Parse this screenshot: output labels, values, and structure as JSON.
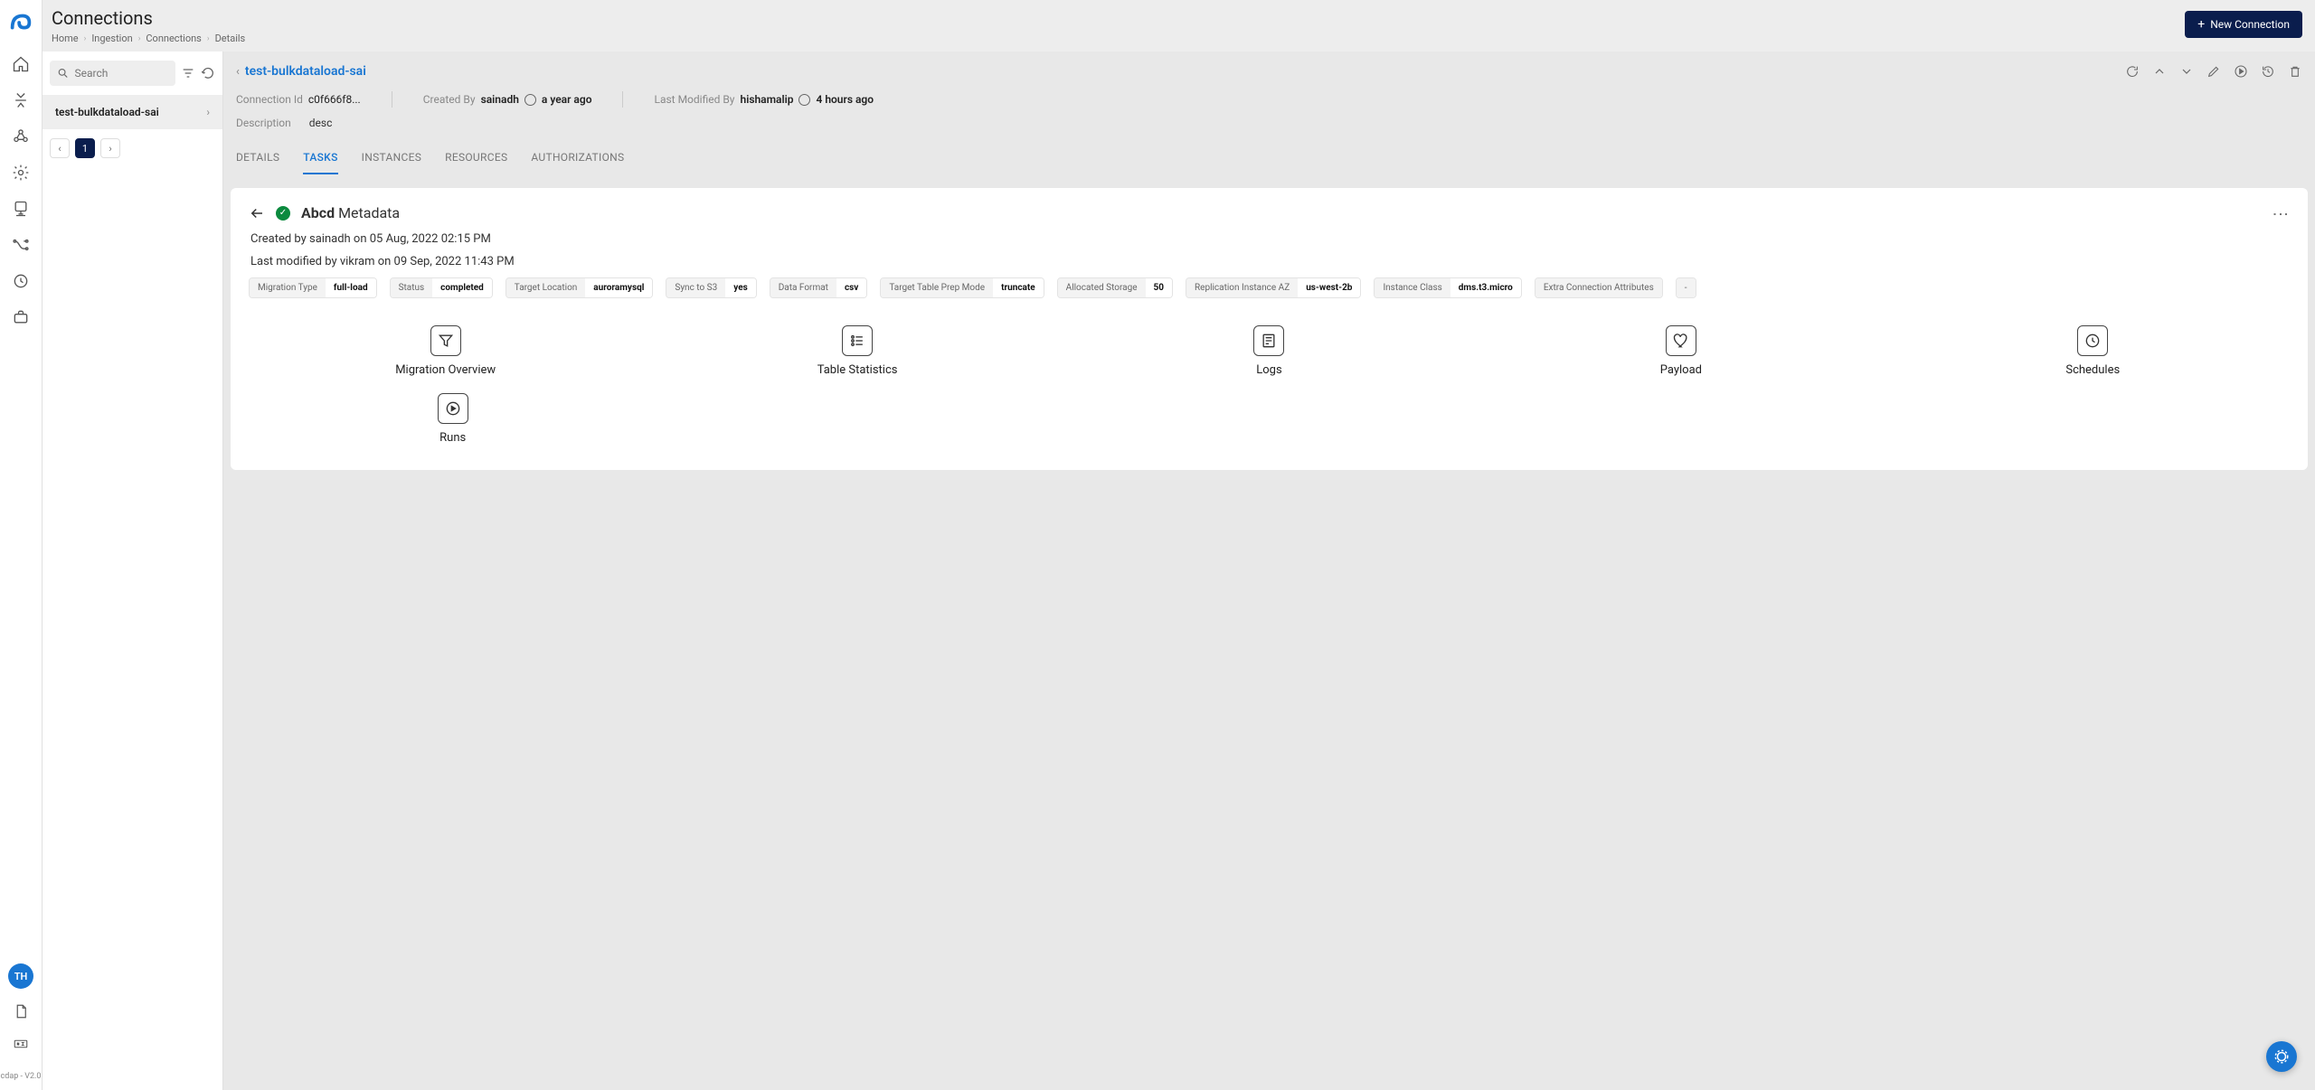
{
  "page": {
    "title": "Connections",
    "breadcrumb": [
      "Home",
      "Ingestion",
      "Connections",
      "Details"
    ],
    "new_connection_btn": "New Connection",
    "version": "cdap - V2.0"
  },
  "search": {
    "placeholder": "Search"
  },
  "avatar": {
    "initials": "TH"
  },
  "sidebar": {
    "items": [
      {
        "label": "test-bulkdataload-sai"
      }
    ],
    "current_page": "1"
  },
  "connection": {
    "name": "test-bulkdataload-sai",
    "id_label": "Connection Id",
    "id_value": "c0f666f8...",
    "created_by_label": "Created By",
    "created_by_value": "sainadh",
    "created_by_time": "a year ago",
    "modified_by_label": "Last Modified By",
    "modified_by_value": "hishamalip",
    "modified_by_time": "4 hours ago",
    "description_label": "Description",
    "description_value": "desc"
  },
  "tabs": {
    "details": "DETAILS",
    "tasks": "TASKS",
    "instances": "INSTANCES",
    "resources": "RESOURCES",
    "authorizations": "AUTHORIZATIONS"
  },
  "task": {
    "name_bold": "Abcd",
    "name_rest": "Metadata",
    "created_line": "Created by sainadh on 05 Aug, 2022 02:15 PM",
    "modified_line": "Last modified by vikram on 09 Sep, 2022 11:43 PM",
    "pills": [
      {
        "k": "Migration Type",
        "v": "full-load"
      },
      {
        "k": "Status",
        "v": "completed"
      },
      {
        "k": "Target Location",
        "v": "auroramysql"
      },
      {
        "k": "Sync to S3",
        "v": "yes"
      },
      {
        "k": "Data Format",
        "v": "csv"
      },
      {
        "k": "Target Table Prep Mode",
        "v": "truncate"
      },
      {
        "k": "Allocated Storage",
        "v": "50"
      },
      {
        "k": "Replication Instance AZ",
        "v": "us-west-2b"
      },
      {
        "k": "Instance Class",
        "v": "dms.t3.micro"
      },
      {
        "k": "Extra Connection Attributes",
        "v": ""
      }
    ],
    "dash": "-"
  },
  "tiles": {
    "migration_overview": "Migration Overview",
    "table_statistics": "Table Statistics",
    "logs": "Logs",
    "payload": "Payload",
    "schedules": "Schedules",
    "runs": "Runs"
  }
}
